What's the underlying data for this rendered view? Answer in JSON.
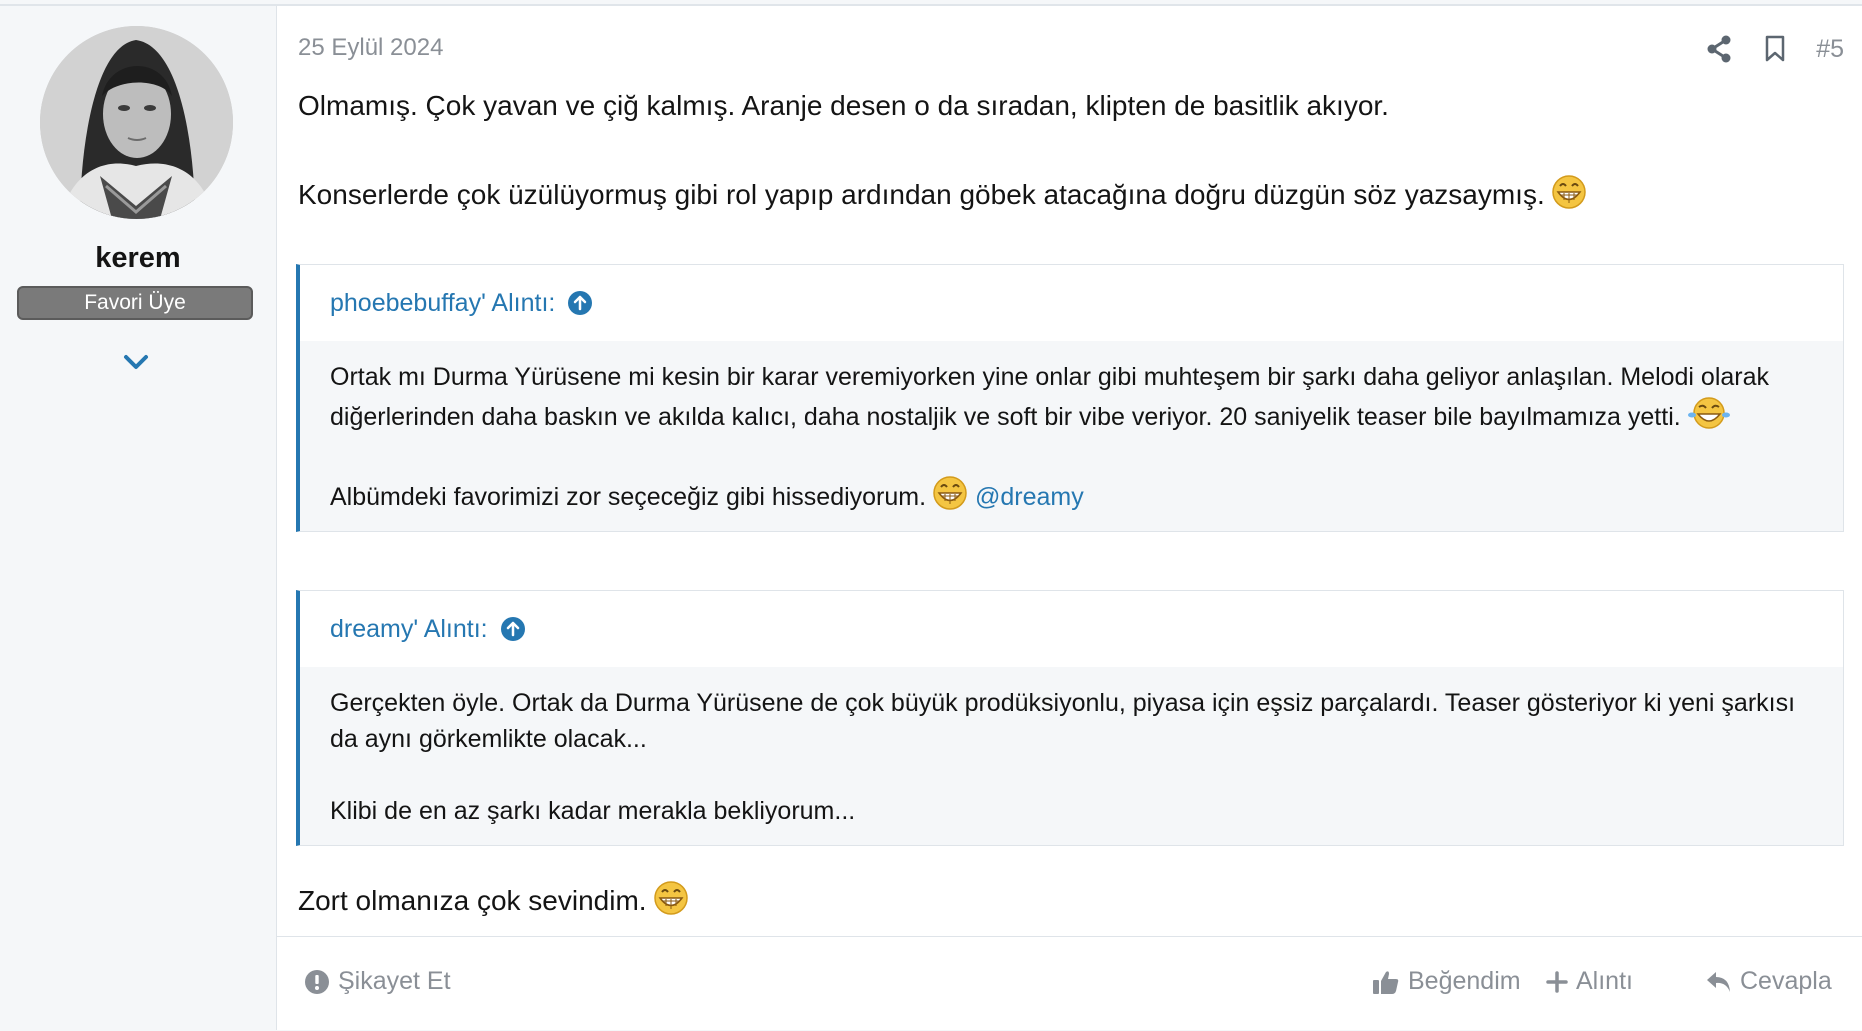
{
  "user": {
    "name": "kerem",
    "title": "Favori Üye"
  },
  "post": {
    "date": "25 Eylül 2024",
    "number": "#5",
    "paragraph1": "Olmamış. Çok yavan ve çiğ kalmış. Aranje desen o da sıradan, klipten de basitlik akıyor.",
    "paragraph2": "Konserlerde çok üzülüyormuş gibi rol yapıp ardından göbek atacağına doğru düzgün söz yazsaymış.",
    "closing": "Zort olmanıza çok sevindim."
  },
  "quotes": [
    {
      "header": "phoebebuffay' Alıntı:",
      "line1": "Ortak mı Durma Yürüsene mi kesin bir karar veremiyorken yine onlar gibi muhteşem bir şarkı daha geliyor anlaşılan. Melodi olarak diğerlerinden daha baskın ve akılda kalıcı, daha nostaljik ve soft bir vibe veriyor. 20 saniyelik teaser bile bayılmamıza yetti.",
      "line2": "Albümdeki favorimizi zor seçeceğiz gibi hissediyorum.",
      "mention": "@dreamy"
    },
    {
      "header": "dreamy' Alıntı:",
      "line1": "Gerçekten öyle. Ortak da Durma Yürüsene de çok büyük prodüksiyonlu, piyasa için eşsiz parçalardı. Teaser gösteriyor ki yeni şarkısı da aynı görkemlikte olacak...",
      "line2": "Klibi de en az şarkı kadar merakla bekliyorum..."
    }
  ],
  "footer": {
    "report": "Şikayet Et",
    "like": "Beğendim",
    "quote": "Alıntı",
    "reply": "Cevapla"
  },
  "icons": {
    "share": "share-icon",
    "bookmark": "bookmark-icon",
    "expand": "chevron-down-icon",
    "quote_jump": "arrow-up-circle-icon",
    "report": "exclamation-circle-icon",
    "like": "thumbs-up-icon",
    "add": "plus-icon",
    "reply": "reply-icon",
    "emoji": "grinning-emoji"
  },
  "colors": {
    "accent": "#2577b1",
    "muted": "#8a8f96",
    "badge": "#7a7a7a",
    "sidebar_bg": "#f5f7f9"
  }
}
